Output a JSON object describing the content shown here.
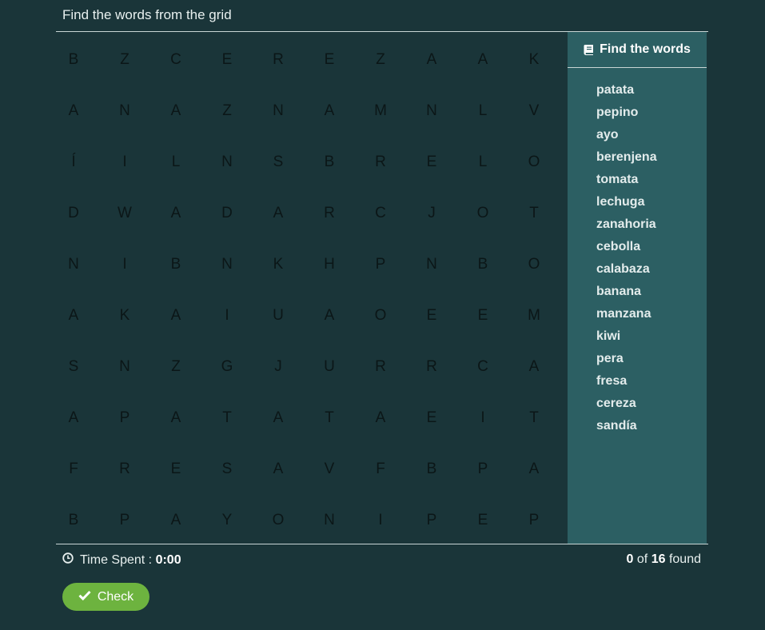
{
  "header": {
    "title": "Find the words from the grid"
  },
  "grid": [
    [
      "B",
      "Z",
      "C",
      "E",
      "R",
      "E",
      "Z",
      "A",
      "A",
      "K"
    ],
    [
      "A",
      "N",
      "A",
      "Z",
      "N",
      "A",
      "M",
      "N",
      "L",
      "V"
    ],
    [
      "Í",
      "I",
      "L",
      "N",
      "S",
      "B",
      "R",
      "E",
      "L",
      "O"
    ],
    [
      "D",
      "W",
      "A",
      "D",
      "A",
      "R",
      "C",
      "J",
      "O",
      "T"
    ],
    [
      "N",
      "I",
      "B",
      "N",
      "K",
      "H",
      "P",
      "N",
      "B",
      "O"
    ],
    [
      "A",
      "K",
      "A",
      "I",
      "U",
      "A",
      "O",
      "E",
      "E",
      "M"
    ],
    [
      "S",
      "N",
      "Z",
      "G",
      "J",
      "U",
      "R",
      "R",
      "C",
      "A"
    ],
    [
      "A",
      "P",
      "A",
      "T",
      "A",
      "T",
      "A",
      "E",
      "I",
      "T"
    ],
    [
      "F",
      "R",
      "E",
      "S",
      "A",
      "V",
      "F",
      "B",
      "P",
      "A"
    ],
    [
      "B",
      "P",
      "A",
      "Y",
      "O",
      "N",
      "I",
      "P",
      "E",
      "P"
    ]
  ],
  "panel": {
    "title": "Find the words",
    "icon": "book-icon",
    "words": [
      "patata",
      "pepino",
      "ayo",
      "berenjena",
      "tomata",
      "lechuga",
      "zanahoria",
      "cebolla",
      "calabaza",
      "banana",
      "manzana",
      "kiwi",
      "pera",
      "fresa",
      "cereza",
      "sandía"
    ]
  },
  "footer": {
    "time_label": "Time Spent :",
    "time_value": "0:00",
    "found_count": "0",
    "found_of": "of",
    "found_total": "16",
    "found_suffix": "found",
    "check_label": "Check"
  },
  "colors": {
    "background": "#1a3539",
    "panel": "#2c5f63",
    "check_button": "#6db33f"
  }
}
